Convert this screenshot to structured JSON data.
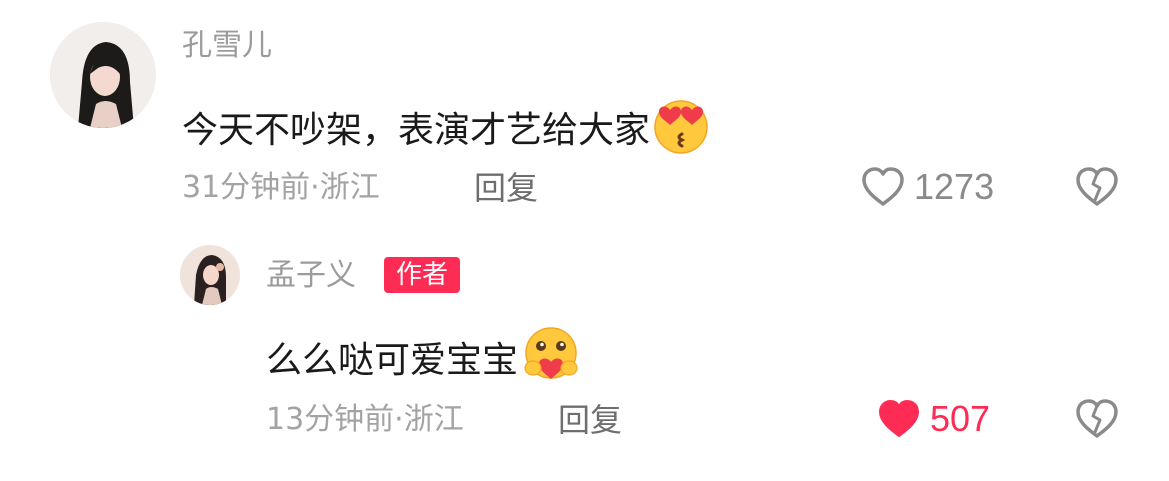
{
  "colors": {
    "accent": "#fe2c55",
    "username": "#9b9b9b",
    "meta": "#a3a3a3",
    "text": "#1a1a1a",
    "icon": "#8a8a8a"
  },
  "comment": {
    "username": "孔雪儿",
    "text": "今天不吵架，表演才艺给大家",
    "emoji": "heart-eyes-kiss-emoji",
    "time": "31分钟前",
    "location": "浙江",
    "meta": "31分钟前·浙江",
    "reply_label": "回复",
    "like_count": "1273",
    "liked": false
  },
  "reply": {
    "username": "孟子义",
    "badge": "作者",
    "text": "么么哒可爱宝宝",
    "emoji": "hugging-heart-emoji",
    "time": "13分钟前",
    "location": "浙江",
    "meta": "13分钟前·浙江",
    "reply_label": "回复",
    "like_count": "507",
    "liked": true
  }
}
